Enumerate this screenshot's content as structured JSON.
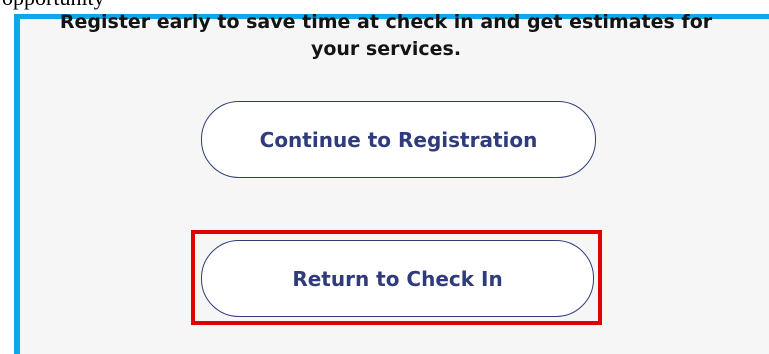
{
  "clipped_top_text": "opportunity",
  "message": {
    "line1": "Register early to save time at check in and get estimates for",
    "line2": "your services."
  },
  "buttons": {
    "continue_label": "Continue to Registration",
    "return_label": "Return to Check In"
  },
  "colors": {
    "panel_border": "#0fa8e6",
    "button_text": "#2f3b7a",
    "highlight": "#e00000"
  }
}
